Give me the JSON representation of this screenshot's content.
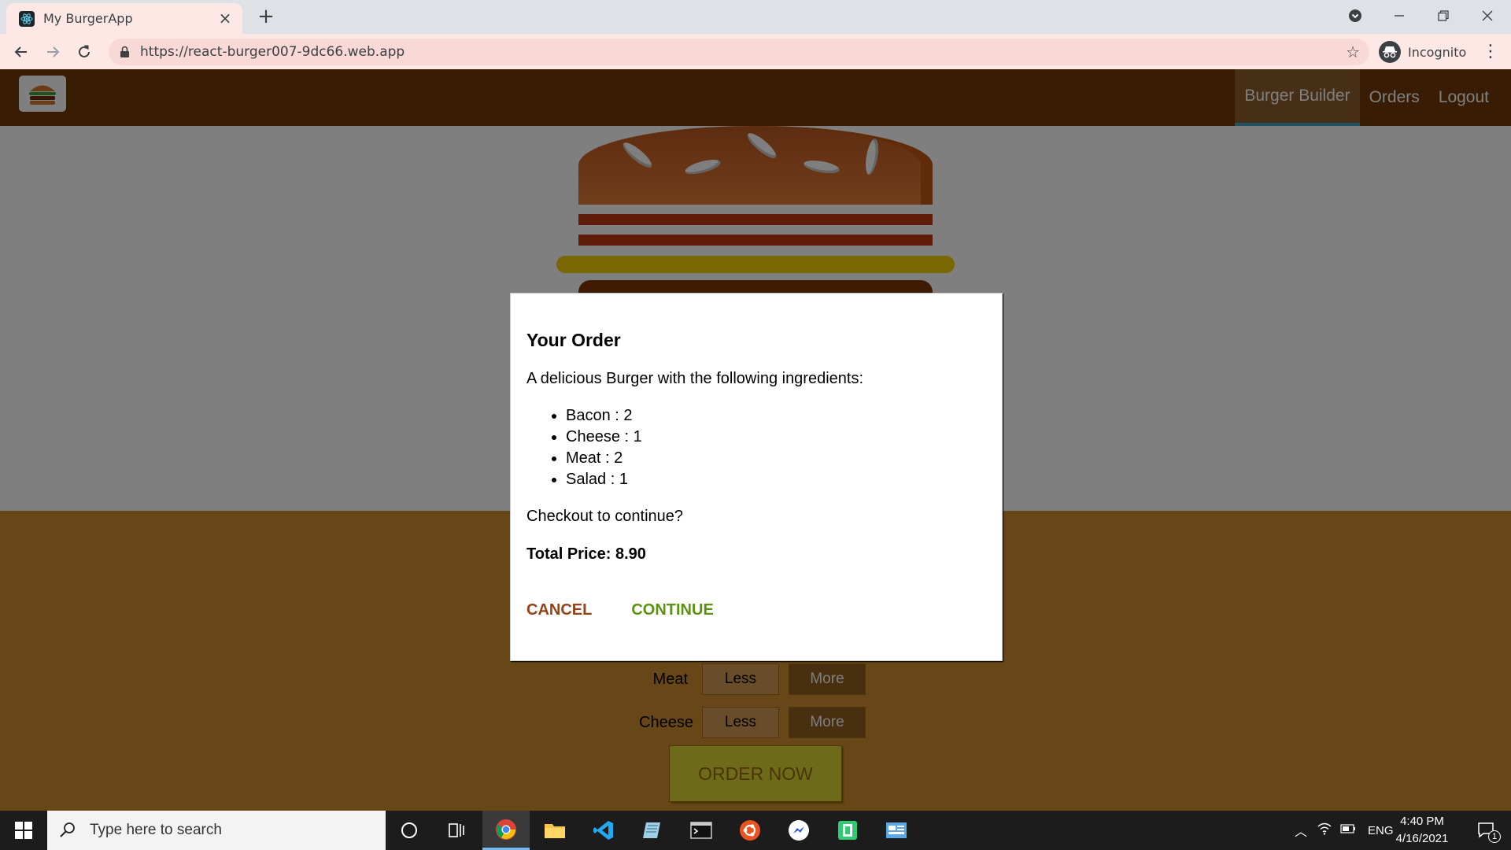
{
  "browser": {
    "tab_title": "My BurgerApp",
    "url": "https://react-burger007-9dc66.web.app",
    "profile_label": "Incognito"
  },
  "app": {
    "nav": [
      "Burger Builder",
      "Orders",
      "Logout"
    ],
    "active_nav": "Burger Builder",
    "controls": [
      {
        "label": "Meat",
        "less": "Less",
        "more": "More"
      },
      {
        "label": "Cheese",
        "less": "Less",
        "more": "More"
      }
    ],
    "order_button": "ORDER NOW"
  },
  "modal": {
    "title": "Your Order",
    "intro": "A delicious Burger with the following ingredients:",
    "ingredients": [
      "Bacon : 2",
      "Cheese : 1",
      "Meat : 2",
      "Salad : 1"
    ],
    "question": "Checkout to continue?",
    "total": "Total Price: 8.90",
    "cancel": "CANCEL",
    "continue": "CONTINUE"
  },
  "taskbar": {
    "search_placeholder": "Type here to search",
    "language": "ENG",
    "time": "4:40 PM",
    "date": "4/16/2021",
    "notification_count": "1"
  },
  "colors": {
    "header": "#703b09",
    "controls_bg": "#cf8f2e",
    "cancel": "#944317",
    "continue": "#5c9210",
    "tab_active": "#fde8e6"
  }
}
